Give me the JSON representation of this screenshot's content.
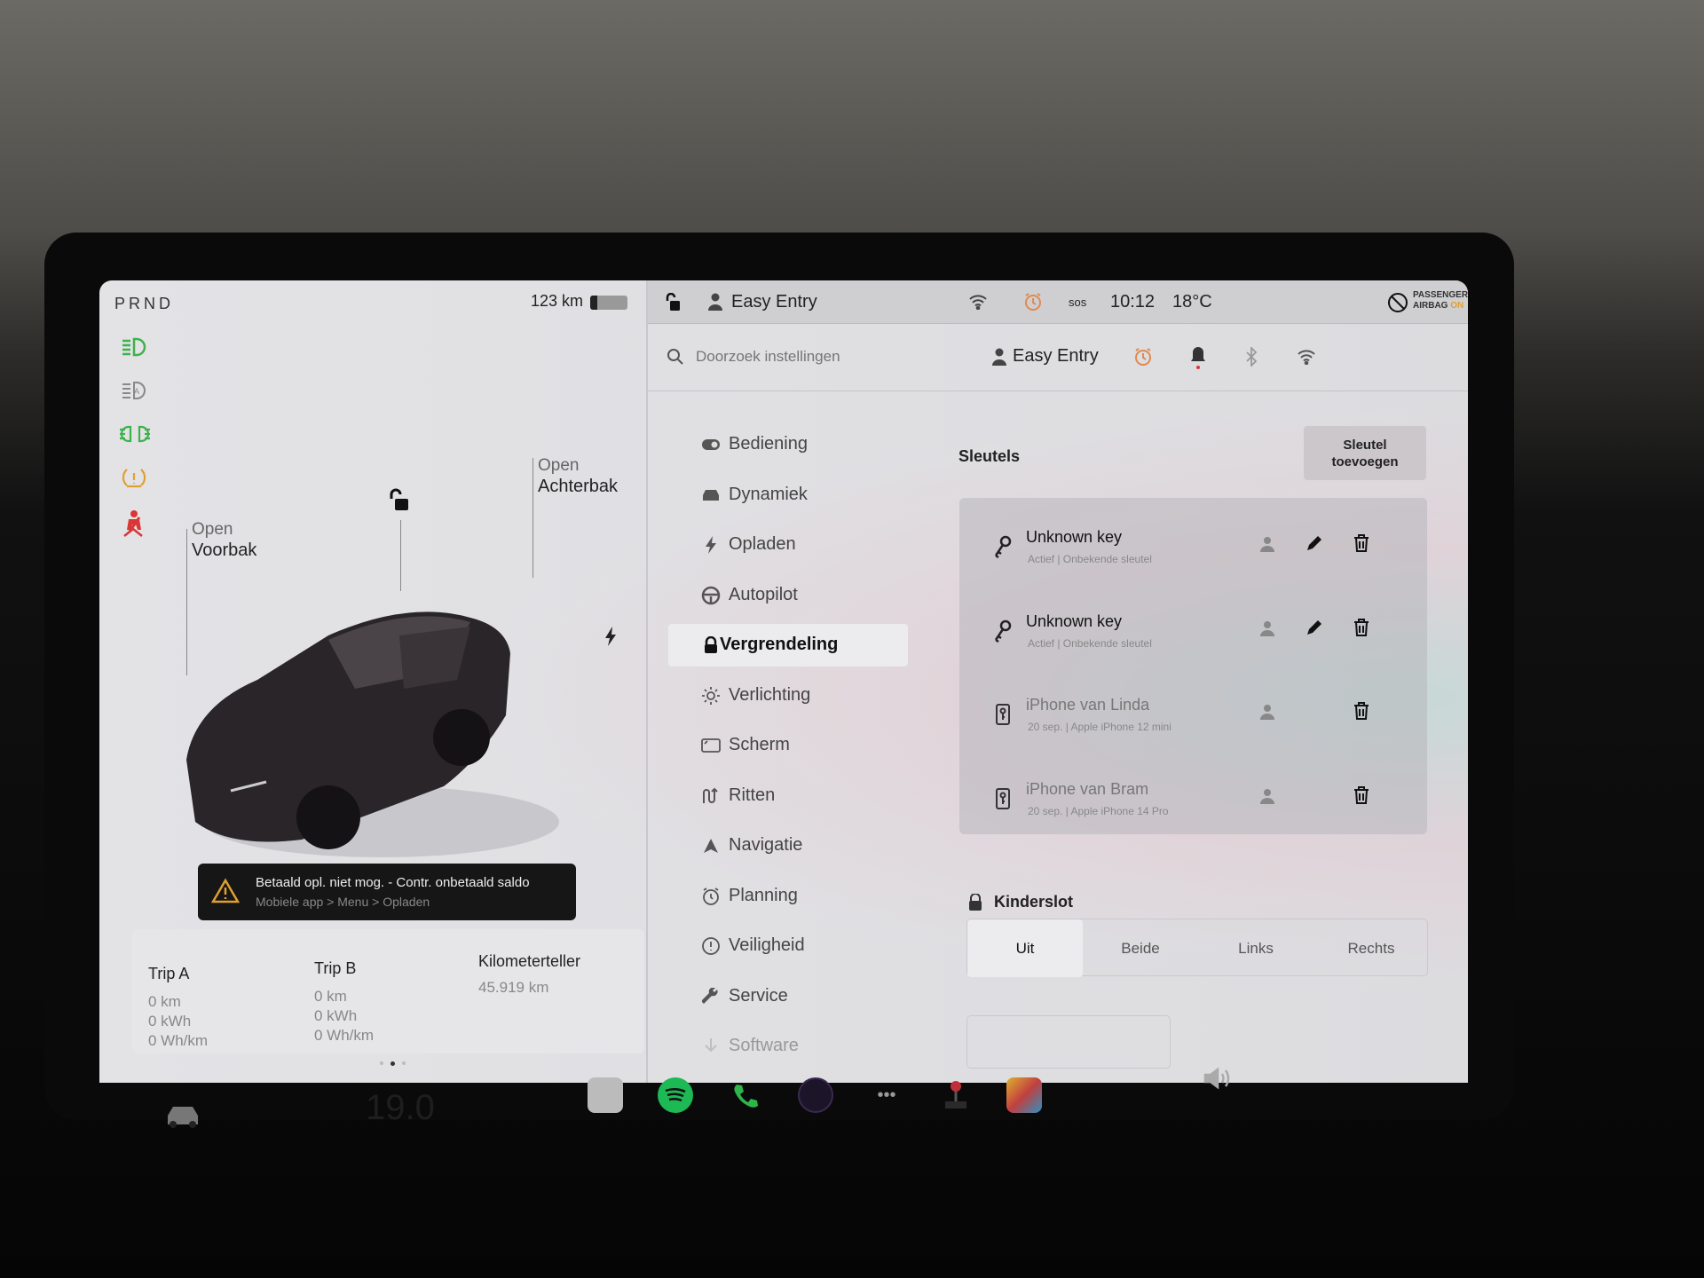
{
  "status_left": {
    "gear": "PRND",
    "range": "123 km",
    "battery_percent": 20
  },
  "indicators": [
    {
      "icon": "low-beam-icon",
      "color": "#3db24b"
    },
    {
      "icon": "auto-high-beam-icon",
      "color": "#888888"
    },
    {
      "icon": "fog-lights-icon",
      "color": "#3db24b"
    },
    {
      "icon": "tire-pressure-warning-icon",
      "color": "#e0a030"
    },
    {
      "icon": "seatbelt-warning-icon",
      "color": "#d93636"
    }
  ],
  "car": {
    "frunk_action": "Open",
    "frunk_label": "Voorbak",
    "trunk_action": "Open",
    "trunk_label": "Achterbak"
  },
  "alert": {
    "title": "Betaald opl. niet mog. - Contr. onbetaald saldo",
    "subtitle": "Mobiele app > Menu > Opladen"
  },
  "trips": {
    "trip_a": {
      "label": "Trip A",
      "km": "0 km",
      "kwh": "0 kWh",
      "eff": "0 Wh/km"
    },
    "trip_b": {
      "label": "Trip B",
      "km": "0 km",
      "kwh": "0 kWh",
      "eff": "0 Wh/km"
    },
    "odometer": {
      "label": "Kilometerteller",
      "value": "45.919 km"
    }
  },
  "status_bar": {
    "profile": "Easy Entry",
    "time": "10:12",
    "temp": "18°C",
    "sos": "SOS",
    "airbag_line1": "PASSENGER",
    "airbag_line2": "AIRBAG",
    "airbag_state": "ON"
  },
  "search": {
    "placeholder": "Doorzoek instellingen",
    "profile": "Easy Entry"
  },
  "menu": [
    {
      "label": "Bediening",
      "icon": "toggle-icon"
    },
    {
      "label": "Dynamiek",
      "icon": "car-icon"
    },
    {
      "label": "Opladen",
      "icon": "bolt-icon"
    },
    {
      "label": "Autopilot",
      "icon": "steering-wheel-icon"
    },
    {
      "label": "Vergrendeling",
      "icon": "lock-icon",
      "active": true
    },
    {
      "label": "Verlichting",
      "icon": "sun-icon"
    },
    {
      "label": "Scherm",
      "icon": "display-icon"
    },
    {
      "label": "Ritten",
      "icon": "trips-icon"
    },
    {
      "label": "Navigatie",
      "icon": "navigation-icon"
    },
    {
      "label": "Planning",
      "icon": "alarm-icon"
    },
    {
      "label": "Veiligheid",
      "icon": "alert-circle-icon"
    },
    {
      "label": "Service",
      "icon": "wrench-icon"
    },
    {
      "label": "Software",
      "icon": "download-icon"
    }
  ],
  "keys": {
    "title": "Sleutels",
    "add_button": "Sleutel toevoegen",
    "items": [
      {
        "name": "Unknown key",
        "detail": "Actief | Onbekende sleutel",
        "type": "key",
        "editable": true
      },
      {
        "name": "Unknown key",
        "detail": "Actief | Onbekende sleutel",
        "type": "key",
        "editable": true
      },
      {
        "name": "iPhone van Linda",
        "detail": "20 sep. | Apple iPhone 12 mini",
        "type": "phone",
        "editable": false
      },
      {
        "name": "iPhone van Bram",
        "detail": "20 sep. | Apple iPhone 14 Pro",
        "type": "phone",
        "editable": false
      }
    ]
  },
  "child_lock": {
    "title": "Kinderslot",
    "options": [
      "Uit",
      "Beide",
      "Links",
      "Rechts"
    ],
    "selected": "Uit"
  },
  "dock": {
    "cabin_temp": "19.0"
  }
}
